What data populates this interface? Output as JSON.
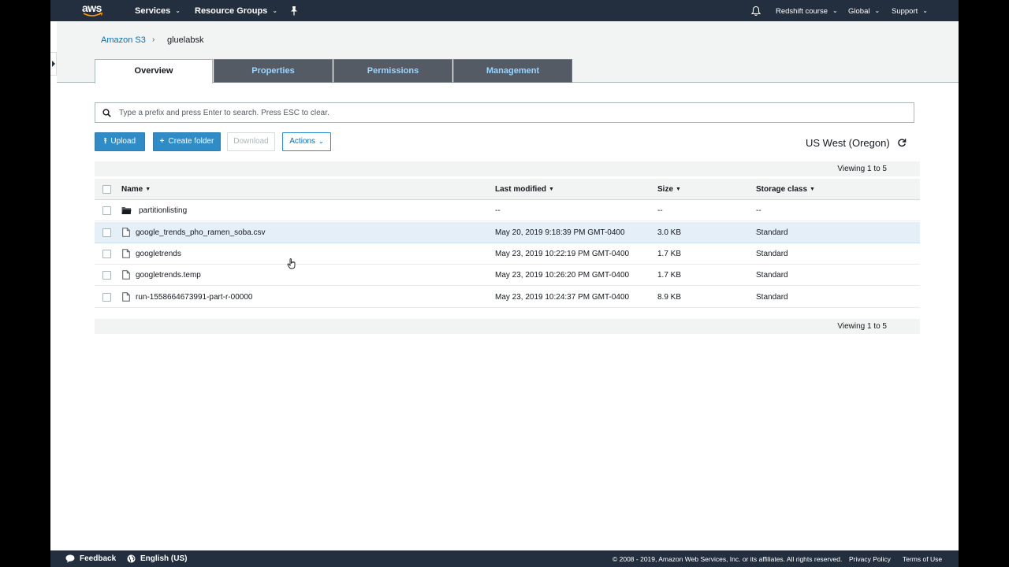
{
  "nav": {
    "logo": "aws",
    "services": "Services",
    "resource_groups": "Resource Groups",
    "account": "Redshift course",
    "region_menu": "Global",
    "support": "Support"
  },
  "breadcrumb": {
    "root": "Amazon S3",
    "separator": "›",
    "current": "gluelabsk"
  },
  "tabs": [
    {
      "label": "Overview",
      "active": true
    },
    {
      "label": "Properties",
      "active": false
    },
    {
      "label": "Permissions",
      "active": false
    },
    {
      "label": "Management",
      "active": false
    }
  ],
  "search": {
    "placeholder": "Type a prefix and press Enter to search. Press ESC to clear.",
    "value": ""
  },
  "toolbar": {
    "upload": "Upload",
    "create_folder": "Create folder",
    "download": "Download",
    "actions": "Actions",
    "region": "US West (Oregon)"
  },
  "table": {
    "viewing_top": "Viewing 1 to 5",
    "viewing_bottom": "Viewing 1 to 5",
    "columns": {
      "name": "Name",
      "last_modified": "Last modified",
      "size": "Size",
      "storage_class": "Storage class"
    },
    "rows": [
      {
        "type": "folder",
        "name": "partitionlisting",
        "modified": "--",
        "size": "--",
        "storage": "--",
        "selected": false
      },
      {
        "type": "file",
        "name": "google_trends_pho_ramen_soba.csv",
        "modified": "May 20, 2019 9:18:39 PM GMT-0400",
        "size": "3.0 KB",
        "storage": "Standard",
        "selected": true
      },
      {
        "type": "file",
        "name": "googletrends",
        "modified": "May 23, 2019 10:22:19 PM GMT-0400",
        "size": "1.7 KB",
        "storage": "Standard",
        "selected": false
      },
      {
        "type": "file",
        "name": "googletrends.temp",
        "modified": "May 23, 2019 10:26:20 PM GMT-0400",
        "size": "1.7 KB",
        "storage": "Standard",
        "selected": false
      },
      {
        "type": "file",
        "name": "run-1558664673991-part-r-00000",
        "modified": "May 23, 2019 10:24:37 PM GMT-0400",
        "size": "8.9 KB",
        "storage": "Standard",
        "selected": false
      }
    ]
  },
  "footer": {
    "feedback": "Feedback",
    "language": "English (US)",
    "copyright": "© 2008 - 2019, Amazon Web Services, Inc. or its affiliates. All rights reserved.",
    "privacy": "Privacy Policy",
    "terms": "Terms of Use"
  },
  "colors": {
    "nav_bg": "#232f3e",
    "accent": "#2f8cc7",
    "link": "#0073bb",
    "selected_row": "#e4eff7"
  }
}
